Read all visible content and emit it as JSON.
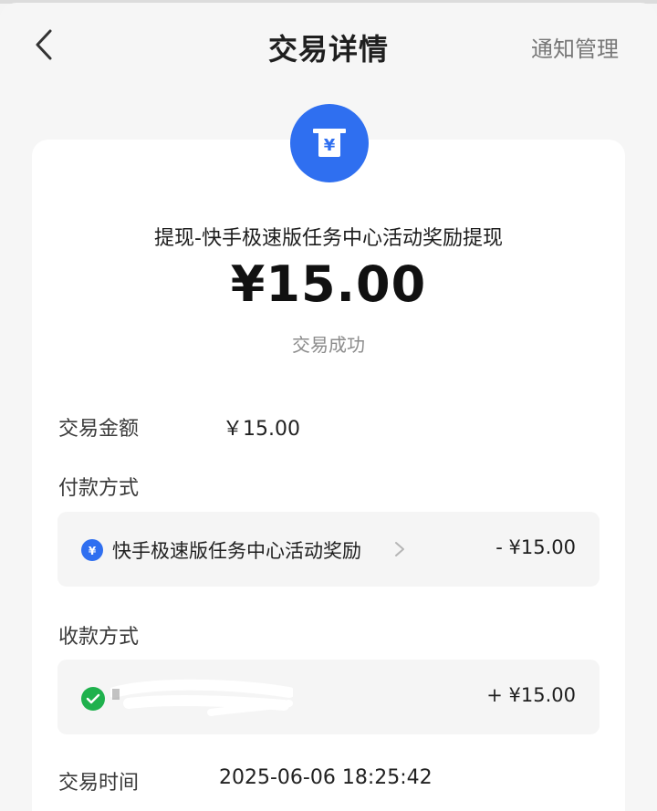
{
  "header": {
    "title": "交易详情",
    "notify_label": "通知管理"
  },
  "summary": {
    "icon": "yuan-receipt-icon",
    "title": "提现-快手极速版任务中心活动奖励提现",
    "amount": "¥15.00",
    "status": "交易成功"
  },
  "details": {
    "amount_label": "交易金额",
    "amount_value": "￥15.00",
    "payment_label": "付款方式",
    "payment": {
      "icon": "yuan-coin-icon",
      "name": "快手极速版任务中心活动奖励",
      "amount": "- ¥15.00"
    },
    "receive_label": "收款方式",
    "receive": {
      "icon": "wechat-icon",
      "name": "",
      "amount": "+ ¥15.00"
    },
    "time_label": "交易时间",
    "time_value": "2025-06-06 18:25:42"
  },
  "colors": {
    "accent": "#2f6ff0",
    "wechat": "#1fb14d",
    "background": "#f6f6f6"
  }
}
